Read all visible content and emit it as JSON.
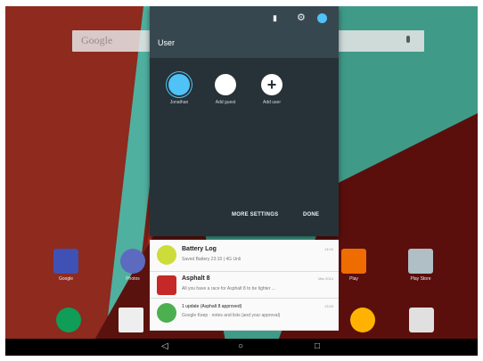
{
  "search": {
    "placeholder": "Google"
  },
  "quick_settings": {
    "title": "User",
    "battery": "▮",
    "users": [
      {
        "name": "Jonathan",
        "active": true
      },
      {
        "name": "Add guest",
        "active": false
      },
      {
        "name": "Add user",
        "active": false
      }
    ],
    "more_settings_label": "MORE SETTINGS",
    "done_label": "DONE"
  },
  "notifications": [
    {
      "title": "Battery Log",
      "subtitle": "Saved Battery 23:10 | 4G Unli",
      "time": "14:04",
      "icon": "battery-icon",
      "color": "#cddc39"
    },
    {
      "title": "Asphalt 8",
      "subtitle": "All you have a race for Asphalt 8 to be tighter ...",
      "time": "Mar 2014",
      "icon": "car-game-icon",
      "color": "#c62828"
    },
    {
      "title": "1 update (Asphalt 8 approved)",
      "subtitle": "Google Keep · notes and lists (and your approval)",
      "time": "13:53",
      "icon": "store-icon",
      "color": "#4caf50"
    }
  ],
  "apps": [
    {
      "label": "Google",
      "icon": "google-plus-icon",
      "color": "#3f51b5"
    },
    {
      "label": "Photos",
      "icon": "photos-app-icon",
      "color": "#5c6bc0"
    },
    {
      "label": "Play",
      "icon": "play-newsstand-icon",
      "color": "#ef6c00"
    },
    {
      "label": "Play Store",
      "icon": "play-store-icon",
      "color": "#b0bec5"
    }
  ],
  "dock": [
    {
      "icon": "hangouts-icon",
      "color": "#0f9d58"
    },
    {
      "icon": "gmail-icon",
      "color": "#eeeeee"
    },
    {
      "icon": "pinwheel-icon",
      "color": "#ffb300"
    },
    {
      "icon": "camera-app-icon",
      "color": "#e0e0e0"
    }
  ],
  "nav": {
    "back": "◁",
    "home": "○",
    "recents": "□"
  }
}
